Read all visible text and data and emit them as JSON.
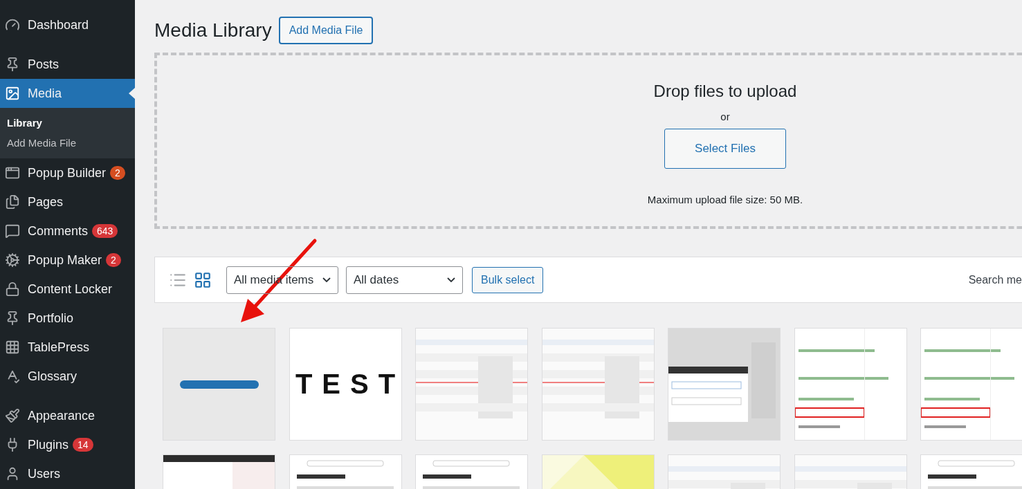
{
  "sidebar": {
    "items": [
      {
        "label": "Dashboard",
        "selected": false,
        "gap_after": true
      },
      {
        "label": "Posts",
        "selected": false
      },
      {
        "label": "Media",
        "selected": true,
        "children": [
          {
            "label": "Library",
            "selected": true
          },
          {
            "label": "Add Media File",
            "selected": false
          }
        ]
      },
      {
        "label": "Popup Builder",
        "selected": false,
        "badge": {
          "text": "2",
          "color": "#d54e21"
        }
      },
      {
        "label": "Pages",
        "selected": false
      },
      {
        "label": "Comments",
        "selected": false,
        "badge": {
          "text": "643",
          "color": "#d63638"
        }
      },
      {
        "label": "Popup Maker",
        "selected": false,
        "badge": {
          "text": "2",
          "color": "#d63638"
        }
      },
      {
        "label": "Content Locker",
        "selected": false
      },
      {
        "label": "Portfolio",
        "selected": false
      },
      {
        "label": "TablePress",
        "selected": false
      },
      {
        "label": "Glossary",
        "selected": false,
        "gap_after": true
      },
      {
        "label": "Appearance",
        "selected": false
      },
      {
        "label": "Plugins",
        "selected": false,
        "badge": {
          "text": "14",
          "color": "#d63638"
        }
      },
      {
        "label": "Users",
        "selected": false
      }
    ]
  },
  "header": {
    "title": "Media Library",
    "button": "Add Media File"
  },
  "uploader": {
    "heading": "Drop files to upload",
    "or": "or",
    "button": "Select Files",
    "note": "Maximum upload file size: 50 MB."
  },
  "toolbar": {
    "views": [
      {
        "kind": "list",
        "selected": false
      },
      {
        "kind": "grid",
        "selected": true
      }
    ],
    "filters": [
      "All media items",
      "All dates"
    ],
    "bulk_button": "Bulk select",
    "search_label": "Search me"
  },
  "thumbnails": [
    {
      "kind": "bar"
    },
    {
      "kind": "text",
      "text": "TEST"
    },
    {
      "kind": "table"
    },
    {
      "kind": "table"
    },
    {
      "kind": "dialog"
    },
    {
      "kind": "code"
    },
    {
      "kind": "code"
    },
    {
      "kind": "dark"
    },
    {
      "kind": "page"
    },
    {
      "kind": "page"
    },
    {
      "kind": "yellow"
    },
    {
      "kind": "table"
    },
    {
      "kind": "table"
    },
    {
      "kind": "page"
    }
  ],
  "annotation": {
    "kind": "arrow"
  }
}
